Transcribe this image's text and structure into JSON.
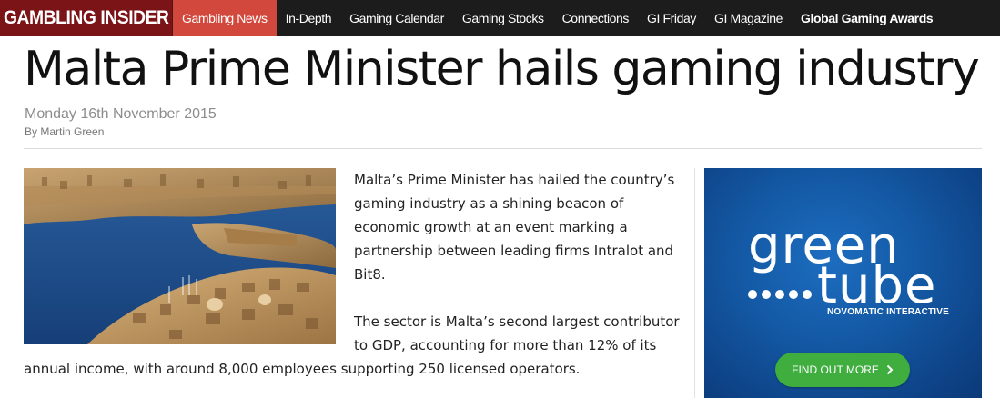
{
  "site": {
    "logo": "GAMBLING INSIDER"
  },
  "nav": {
    "items": [
      {
        "label": "Gambling News",
        "active": true
      },
      {
        "label": "In-Depth"
      },
      {
        "label": "Gaming Calendar"
      },
      {
        "label": "Gaming Stocks"
      },
      {
        "label": "Connections"
      },
      {
        "label": "GI Friday"
      },
      {
        "label": "GI Magazine"
      },
      {
        "label": "Global Gaming Awards"
      }
    ]
  },
  "article": {
    "title": "Malta Prime Minister hails gaming industry",
    "date": "Monday 16th November 2015",
    "byline": "By Martin Green",
    "paragraph1": "Malta’s Prime Minister has hailed the country’s gaming industry as a shining beacon of economic growth at an event marking a partnership between leading firms Intralot and Bit8.",
    "paragraph2_part1": "The sector is Malta’s second largest contributor to GDP, accounting for more than 12% of its",
    "paragraph2_part2": "annual income, with around 8,000 employees supporting 250 licensed operators."
  },
  "ad": {
    "brand_line1": "green",
    "brand_line2": "tube",
    "tagline": "NOVOMATIC INTERACTIVE",
    "cta": "FIND OUT MORE"
  },
  "colors": {
    "nav_bg": "#1c1c1c",
    "logo_bg": "#7a1417",
    "active_tab": "#d2483c",
    "ad_blue": "#145aa6",
    "cta_green": "#3fae3f"
  }
}
